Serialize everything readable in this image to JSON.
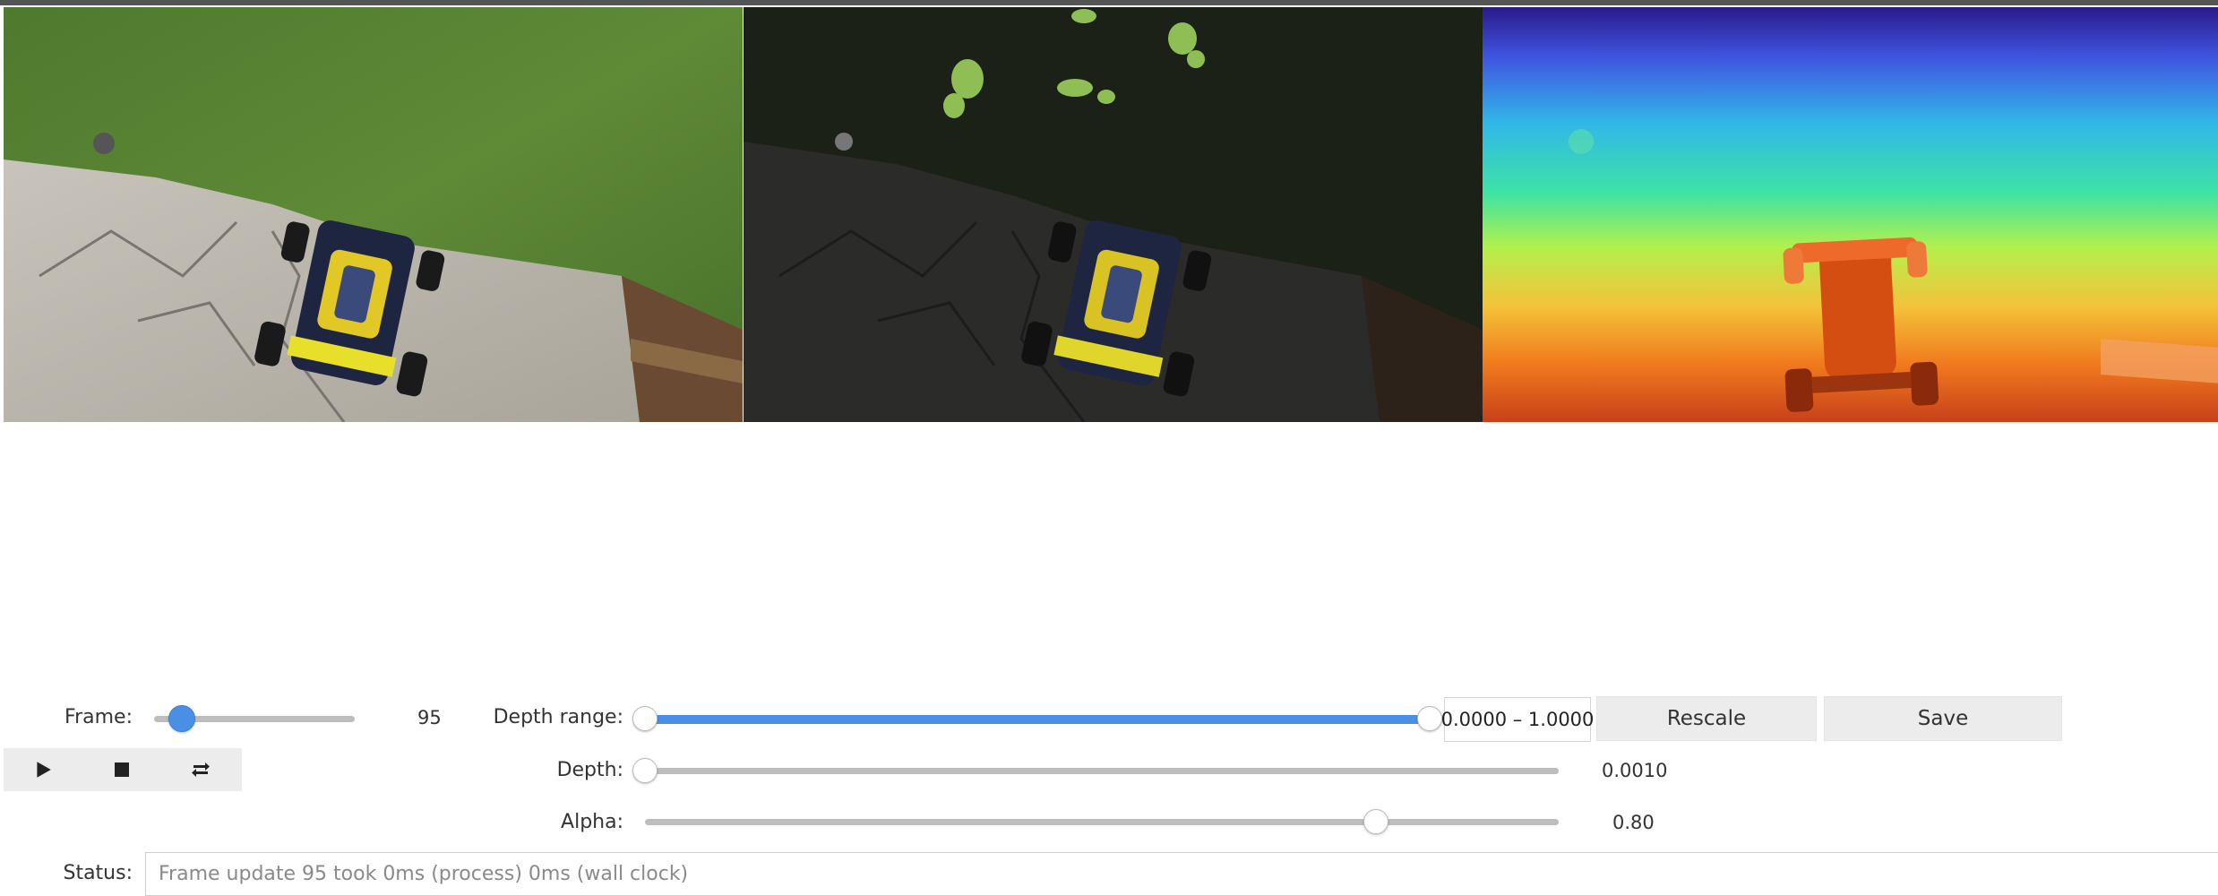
{
  "panels": {
    "rgb": "RGB frame",
    "overlay": "Overlay frame",
    "depth": "Depth map"
  },
  "frame": {
    "label": "Frame:",
    "value": "95",
    "slider_fraction": 0.14
  },
  "playback": {
    "play_icon": "play-icon",
    "stop_icon": "stop-icon",
    "loop_icon": "repeat-icon"
  },
  "depth_range": {
    "label": "Depth range:",
    "value": "0.0000 – 1.0000",
    "low_fraction": 0.0,
    "high_fraction": 1.0
  },
  "buttons": {
    "rescale": "Rescale",
    "save": "Save"
  },
  "depth": {
    "label": "Depth:",
    "value": "0.0010",
    "slider_fraction": 0.0
  },
  "alpha": {
    "label": "Alpha:",
    "value": "0.80",
    "slider_fraction": 0.8
  },
  "status": {
    "label": "Status:",
    "text": "Frame update 95 took 0ms (process) 0ms (wall clock)"
  },
  "colors": {
    "accent": "#4a8fe6",
    "track": "#bdbdbd",
    "button_bg": "#ececec"
  }
}
